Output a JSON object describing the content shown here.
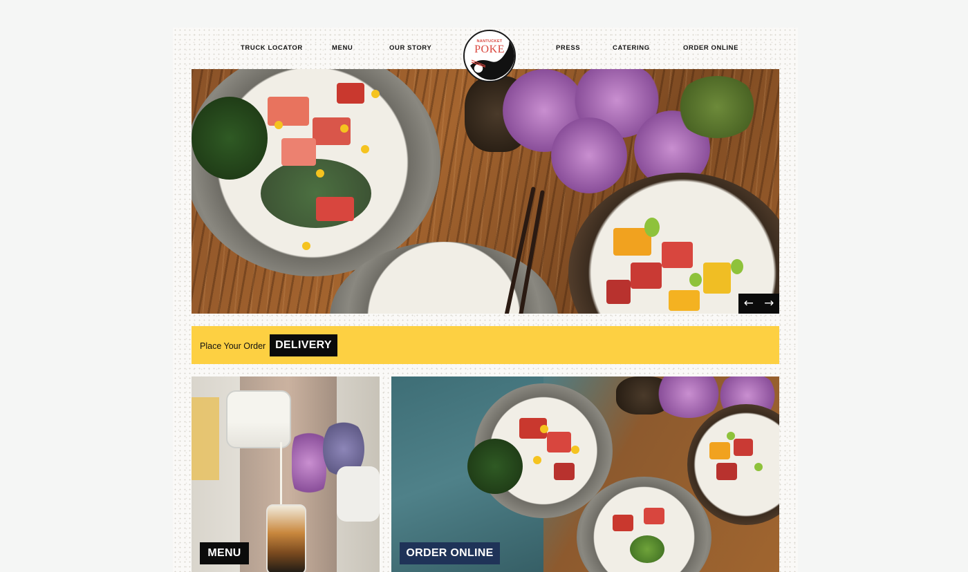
{
  "nav": {
    "left": [
      "TRUCK LOCATOR",
      "MENU",
      "OUR STORY"
    ],
    "right": [
      "PRESS",
      "CATERING",
      "ORDER ONLINE"
    ]
  },
  "logo": {
    "top_text": "NANTUCKET",
    "main_text": "POKE"
  },
  "slider": {
    "prev_icon": "arrow-left-icon",
    "next_icon": "arrow-right-icon",
    "prev_glyph": "←",
    "next_glyph": "→"
  },
  "order_bar": {
    "label": "Place Your Order",
    "button": "DELIVERY"
  },
  "tiles": {
    "menu": "MENU",
    "order_online": "ORDER ONLINE"
  },
  "colors": {
    "order_bar": "#fdd042",
    "button_dark": "#0b0b0b",
    "button_navy": "#1f3358",
    "logo_red": "#d9463e"
  }
}
